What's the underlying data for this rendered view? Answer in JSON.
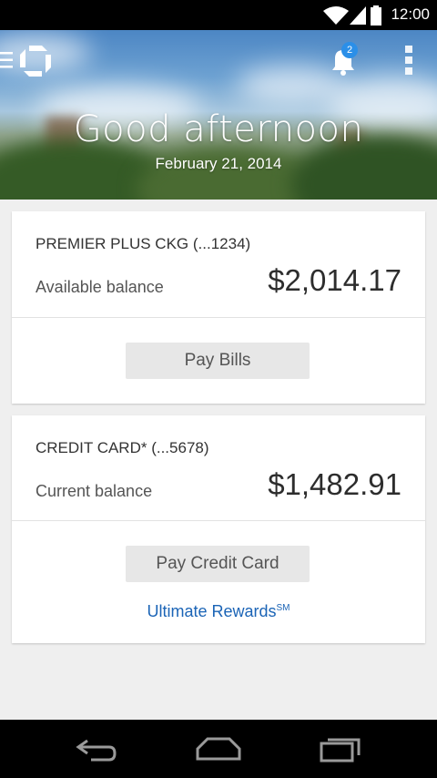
{
  "status_bar": {
    "time": "12:00"
  },
  "header": {
    "greeting": "Good afternoon",
    "date": "February 21, 2014",
    "notification_count": "2"
  },
  "accounts": [
    {
      "name": "PREMIER PLUS CKG (...1234)",
      "balance_label": "Available balance",
      "balance": "$2,014.17",
      "action_label": "Pay Bills"
    },
    {
      "name": "CREDIT CARD* (...5678)",
      "balance_label": "Current balance",
      "balance": "$1,482.91",
      "action_label": "Pay Credit Card",
      "link_label": "Ultimate Rewards",
      "link_superscript": "SM"
    }
  ],
  "colors": {
    "accent": "#1b64b6",
    "badge": "#2b8fe8",
    "button_bg": "#e7e7e7"
  },
  "icons": [
    "wifi-icon",
    "signal-icon",
    "battery-icon",
    "menu-icon",
    "chase-logo",
    "bell-icon",
    "overflow-menu-icon",
    "back-icon",
    "home-icon",
    "recents-icon"
  ]
}
